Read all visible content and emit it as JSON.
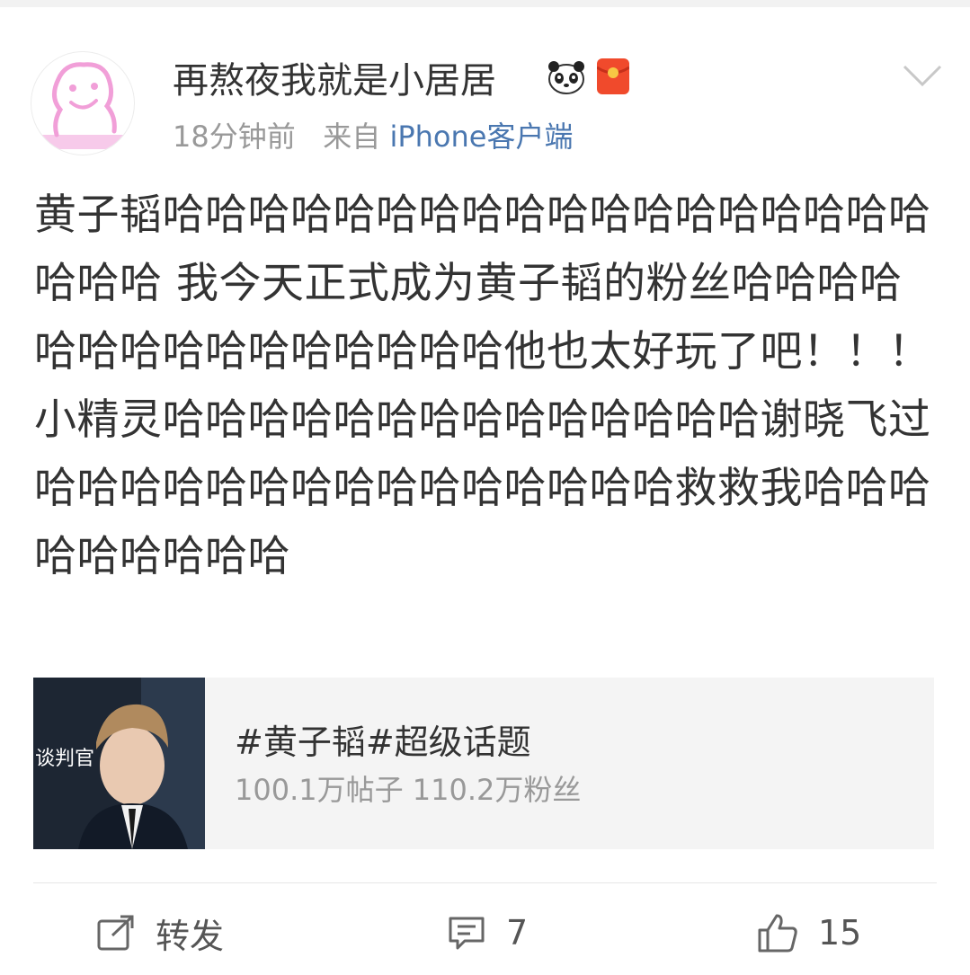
{
  "post": {
    "username": "再熬夜我就是小居居",
    "time": "18分钟前",
    "from_label": "来自",
    "source": "iPhone客户端",
    "content": "黄子韬哈哈哈哈哈哈哈哈哈哈哈哈哈哈哈哈哈哈哈哈哈 我今天正式成为黄子韬的粉丝哈哈哈哈哈哈哈哈哈哈哈哈哈哈哈他也太好玩了吧！！！小精灵哈哈哈哈哈哈哈哈哈哈哈哈哈哈谢晓飞过哈哈哈哈哈哈哈哈哈哈哈哈哈哈哈救救我哈哈哈哈哈哈哈哈哈"
  },
  "topic_card": {
    "image_caption": "谈判官",
    "title": "#黄子韬#超级话题",
    "stats": "100.1万帖子 110.2万粉丝"
  },
  "actions": {
    "repost_label": "转发",
    "comment_count": "7",
    "like_count": "15"
  },
  "colors": {
    "link": "#4a77b0",
    "muted": "#999999",
    "text": "#333333",
    "card_bg": "#f4f4f4",
    "avatar_pink": "#f19fd8"
  },
  "icons": [
    "panda-icon",
    "red-packet-icon",
    "chevron-down-icon",
    "repost-icon",
    "comment-icon",
    "like-icon"
  ]
}
